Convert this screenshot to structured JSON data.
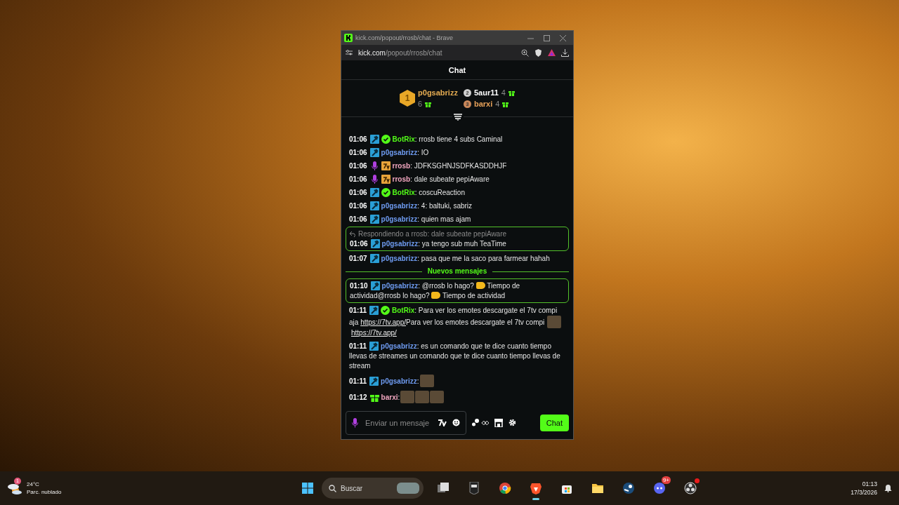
{
  "window": {
    "title": "kick.com/popout/rrosb/chat - Brave",
    "url_host": "kick.com",
    "url_path": "/popout/rrosb/chat"
  },
  "chat": {
    "title": "Chat",
    "leaderboard": [
      {
        "rank": "1",
        "name": "p0gsabrizz",
        "count": "6",
        "color": "#e6ad52"
      },
      {
        "rank": "2",
        "name": "5aur11",
        "count": "4",
        "color": "#ffffff"
      },
      {
        "rank": "3",
        "name": "barxi",
        "count": "4",
        "color": "#e8a25a"
      }
    ],
    "messages": [
      {
        "kind": "message",
        "highlighted": false,
        "time": "01:06",
        "badges": [
          {
            "kind": "mod"
          },
          {
            "kind": "verified"
          }
        ],
        "user": "BotRix",
        "color": "#53fc18",
        "parts": [
          {
            "kind": "text",
            "text": ": rrosb tiene 4 subs Caminal"
          }
        ]
      },
      {
        "kind": "message",
        "highlighted": false,
        "time": "01:06",
        "badges": [
          {
            "kind": "mod"
          }
        ],
        "user": "p0gsabrizz",
        "color": "#6f9cf2",
        "parts": [
          {
            "kind": "text",
            "text": ": IO"
          }
        ]
      },
      {
        "kind": "message",
        "highlighted": false,
        "time": "01:06",
        "badges": [
          {
            "kind": "mic"
          },
          {
            "kind": "seventv"
          }
        ],
        "user": "rrosb",
        "color": "#f2a7c0",
        "parts": [
          {
            "kind": "text",
            "text": ": JDFKSGHNJSDFKASDDHJF"
          }
        ]
      },
      {
        "kind": "message",
        "highlighted": false,
        "time": "01:06",
        "badges": [
          {
            "kind": "mic"
          },
          {
            "kind": "seventv"
          }
        ],
        "user": "rrosb",
        "color": "#f2a7c0",
        "parts": [
          {
            "kind": "text",
            "text": ": dale subeate pepiAware"
          }
        ]
      },
      {
        "kind": "message",
        "highlighted": false,
        "time": "01:06",
        "badges": [
          {
            "kind": "mod"
          },
          {
            "kind": "verified"
          }
        ],
        "user": "BotRix",
        "color": "#53fc18",
        "parts": [
          {
            "kind": "text",
            "text": ": coscuReaction"
          }
        ]
      },
      {
        "kind": "message",
        "highlighted": false,
        "time": "01:06",
        "badges": [
          {
            "kind": "mod"
          }
        ],
        "user": "p0gsabrizz",
        "color": "#6f9cf2",
        "parts": [
          {
            "kind": "text",
            "text": ": 4: baltuki, sabriz"
          }
        ]
      },
      {
        "kind": "message",
        "highlighted": false,
        "time": "01:06",
        "badges": [
          {
            "kind": "mod"
          }
        ],
        "user": "p0gsabrizz",
        "color": "#6f9cf2",
        "parts": [
          {
            "kind": "text",
            "text": ": quien mas ajam"
          }
        ]
      },
      {
        "kind": "message",
        "highlighted": true,
        "reply": "Respondiendo a rrosb: dale subeate pepiAware",
        "time": "01:06",
        "badges": [
          {
            "kind": "mod"
          }
        ],
        "user": "p0gsabrizz",
        "color": "#6f9cf2",
        "parts": [
          {
            "kind": "text",
            "text": ": ya tengo sub muh TeaTime"
          }
        ]
      },
      {
        "kind": "message",
        "highlighted": false,
        "time": "01:07",
        "badges": [
          {
            "kind": "mod"
          }
        ],
        "user": "p0gsabrizz",
        "color": "#6f9cf2",
        "parts": [
          {
            "kind": "text",
            "text": ": pasa que me la saco para farmear hahah"
          }
        ]
      },
      {
        "kind": "divider",
        "label": "Nuevos mensajes"
      },
      {
        "kind": "message",
        "highlighted": true,
        "time": "01:10",
        "badges": [
          {
            "kind": "mod"
          }
        ],
        "user": "p0gsabrizz",
        "color": "#6f9cf2",
        "parts": [
          {
            "kind": "text",
            "text": ": @rrosb lo hago? "
          },
          {
            "kind": "emoji"
          },
          {
            "kind": "text",
            "text": " Tiempo de actividad@rrosb lo hago? "
          },
          {
            "kind": "emoji"
          },
          {
            "kind": "text",
            "text": " Tiempo de actividad"
          }
        ]
      },
      {
        "kind": "message",
        "highlighted": false,
        "time": "01:11",
        "badges": [
          {
            "kind": "mod"
          },
          {
            "kind": "verified"
          }
        ],
        "user": "BotRix",
        "color": "#53fc18",
        "parts": [
          {
            "kind": "text",
            "text": ": Para ver los emotes descargate el 7tv compi aja "
          },
          {
            "kind": "link",
            "text": "https://7tv.app/"
          },
          {
            "kind": "text",
            "text": "Para ver los emotes descargate el 7tv compi "
          },
          {
            "kind": "emote"
          },
          {
            "kind": "link",
            "text": "https://7tv.app/"
          }
        ]
      },
      {
        "kind": "message",
        "highlighted": false,
        "time": "01:11",
        "badges": [
          {
            "kind": "mod"
          }
        ],
        "user": "p0gsabrizz",
        "color": "#6f9cf2",
        "parts": [
          {
            "kind": "text",
            "text": ": es un comando que te dice cuanto tiempo llevas de streames un comando que te dice cuanto tiempo llevas de stream"
          }
        ]
      },
      {
        "kind": "message",
        "highlighted": false,
        "time": "01:11",
        "badges": [
          {
            "kind": "mod"
          }
        ],
        "user": "p0gsabrizz",
        "color": "#6f9cf2",
        "parts": [
          {
            "kind": "text",
            "text": ":"
          },
          {
            "kind": "emote"
          }
        ]
      },
      {
        "kind": "message",
        "highlighted": false,
        "time": "01:12",
        "badges": [
          {
            "kind": "gift"
          }
        ],
        "user": "barxi",
        "color": "#f2a7c0",
        "parts": [
          {
            "kind": "text",
            "text": ":"
          },
          {
            "kind": "emote"
          },
          {
            "kind": "emote"
          },
          {
            "kind": "emote"
          }
        ]
      }
    ],
    "input": {
      "placeholder": "Enviar un mensaje"
    },
    "send_button": "Chat"
  },
  "taskbar": {
    "weather": {
      "badge": "1",
      "temperature": "24°C",
      "condition": "Parc. nublado"
    },
    "search": {
      "placeholder": "Buscar"
    },
    "apps": [
      {
        "kind": "taskview",
        "selected": false,
        "alert": false
      },
      {
        "kind": "epic",
        "selected": false,
        "alert": false
      },
      {
        "kind": "chrome",
        "selected": false,
        "alert": false
      },
      {
        "kind": "brave",
        "selected": true,
        "alert": false
      },
      {
        "kind": "store",
        "selected": false,
        "alert": false
      },
      {
        "kind": "files",
        "selected": false,
        "alert": false
      },
      {
        "kind": "steam",
        "selected": false,
        "alert": false
      },
      {
        "kind": "discord",
        "selected": false,
        "alert": false,
        "badge": "9+"
      },
      {
        "kind": "obs",
        "selected": false,
        "alert": true
      }
    ],
    "time": "01:13",
    "date": "17/3/2026"
  }
}
